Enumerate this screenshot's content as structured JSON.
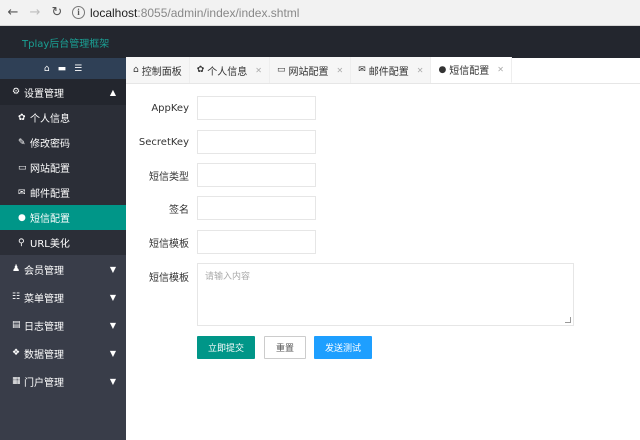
{
  "browser": {
    "url_host": "localhost",
    "url_path": ":8055/admin/index/index.shtml",
    "back_icon": "arrow-left-icon",
    "forward_icon": "arrow-right-icon",
    "reload_icon": "reload-icon"
  },
  "header": {
    "brand": "Tplay后台管理框架",
    "brand_color": "#1aa094",
    "bg_color": "#23262e"
  },
  "sidebar": {
    "tools": [
      "home-icon",
      "trash-icon",
      "menu-icon"
    ],
    "group_settings": {
      "label": "设置管理",
      "icon": "gears-icon",
      "caret": "▲"
    },
    "sub_items": [
      {
        "label": "个人信息",
        "icon": "✿"
      },
      {
        "label": "修改密码",
        "icon": "✎"
      },
      {
        "label": "网站配置",
        "icon": "▭"
      },
      {
        "label": "邮件配置",
        "icon": "✉"
      },
      {
        "label": "短信配置",
        "icon": "●"
      },
      {
        "label": "URL美化",
        "icon": "⚲"
      }
    ],
    "groups": [
      {
        "label": "会员管理",
        "icon": "♟",
        "caret": "▼"
      },
      {
        "label": "菜单管理",
        "icon": "☷",
        "caret": "▼"
      },
      {
        "label": "日志管理",
        "icon": "▤",
        "caret": "▼"
      },
      {
        "label": "数据管理",
        "icon": "❖",
        "caret": "▼"
      },
      {
        "label": "门户管理",
        "icon": "▦",
        "caret": "▼"
      }
    ],
    "active_color": "#009688"
  },
  "tabs": [
    {
      "label": "控制面板",
      "icon": "⌂",
      "closable": false
    },
    {
      "label": "个人信息",
      "icon": "✿",
      "closable": true,
      "close": "✕"
    },
    {
      "label": "网站配置",
      "icon": "▭",
      "closable": true,
      "close": "✕"
    },
    {
      "label": "邮件配置",
      "icon": "✉",
      "closable": true,
      "close": "✕"
    },
    {
      "label": "短信配置",
      "icon": "●",
      "closable": true,
      "close": "✕"
    }
  ],
  "form": {
    "fields": [
      {
        "label": "AppKey",
        "value": ""
      },
      {
        "label": "SecretKey",
        "value": ""
      },
      {
        "label": "短信类型",
        "value": ""
      },
      {
        "label": "签名",
        "value": ""
      },
      {
        "label": "短信模板",
        "value": ""
      }
    ],
    "textarea": {
      "label": "短信模板",
      "placeholder": "请输入内容"
    },
    "buttons": {
      "submit": "立即提交",
      "reset": "重置",
      "test": "发送测试"
    }
  }
}
